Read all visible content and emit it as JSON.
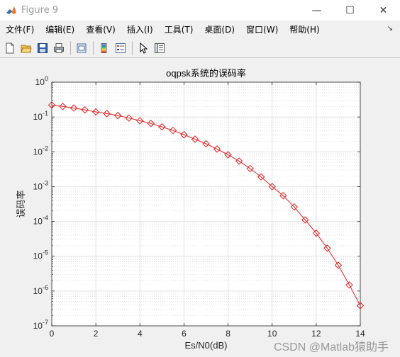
{
  "window": {
    "title": "Figure 9",
    "minimize_glyph": "—",
    "maximize_glyph": "☐",
    "close_glyph": "✕"
  },
  "menu": {
    "items": [
      {
        "label": "文件(F)",
        "name": "menu-file"
      },
      {
        "label": "编辑(E)",
        "name": "menu-edit"
      },
      {
        "label": "查看(V)",
        "name": "menu-view"
      },
      {
        "label": "插入(I)",
        "name": "menu-insert"
      },
      {
        "label": "工具(T)",
        "name": "menu-tools"
      },
      {
        "label": "桌面(D)",
        "name": "menu-desktop"
      },
      {
        "label": "窗口(W)",
        "name": "menu-window"
      },
      {
        "label": "帮助(H)",
        "name": "menu-help"
      }
    ],
    "overflow_glyph": "↘"
  },
  "toolbar": {
    "icons": [
      "new-figure-icon",
      "open-file-icon",
      "save-icon",
      "print-icon",
      "print-preview-icon",
      "colorbar-icon",
      "legend-icon",
      "edit-plot-arrow-icon",
      "property-inspector-icon"
    ]
  },
  "watermark": "CSDN @Matlab猿助手",
  "chart_data": {
    "type": "line",
    "title": "oqpsk系统的误码率",
    "xlabel": "Es/N0(dB)",
    "ylabel": "误码率",
    "xlim": [
      0,
      14
    ],
    "ylim": [
      1e-07,
      1
    ],
    "yscale": "log",
    "grid": true,
    "minor_grid": true,
    "x_ticks": [
      "0",
      "2",
      "4",
      "6",
      "8",
      "10",
      "12",
      "14"
    ],
    "y_tick_exponents": [
      "0",
      "-1",
      "-2",
      "-3",
      "-4",
      "-5",
      "-6",
      "-7"
    ],
    "y_tick_base": "10",
    "series": [
      {
        "color": "#e02020",
        "marker": "diamond",
        "x": [
          0,
          0.5,
          1,
          1.5,
          2,
          2.5,
          3,
          3.5,
          4,
          4.5,
          5,
          5.5,
          6,
          6.5,
          7,
          7.5,
          8,
          8.5,
          9,
          9.5,
          10,
          10.5,
          11,
          11.5,
          12,
          12.5,
          13,
          13.5,
          14
        ],
        "values": [
          0.22,
          0.2,
          0.18,
          0.16,
          0.14,
          0.125,
          0.11,
          0.093,
          0.078,
          0.065,
          0.052,
          0.041,
          0.031,
          0.023,
          0.017,
          0.012,
          0.0082,
          0.0054,
          0.0033,
          0.0019,
          0.001,
          0.00055,
          0.00026,
          0.00011,
          4.6e-05,
          1.7e-05,
          5.5e-06,
          1.5e-06,
          3.8e-07
        ]
      }
    ]
  }
}
